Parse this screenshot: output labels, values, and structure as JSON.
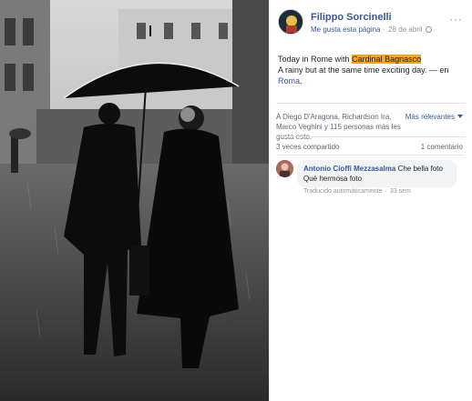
{
  "post": {
    "author": "Filippo Sorcinelli",
    "follow_label": "Me gusta esta página",
    "date": "28 de abril",
    "more_label": "···",
    "text_prefix": "Today in Rome with ",
    "text_highlight": "Cardinal Bagnasco",
    "text_line2": "A rainy but at the same time exciting day.",
    "text_place_sep": " — en ",
    "place": "Roma",
    "place_period": "."
  },
  "stats": {
    "reactions": "A Diego D'Aragona, Richardson Ira, Marco Veghini y 115 personas más les gusta esto.",
    "relevance_label": "Más relevantes",
    "shares": "3 veces compartido",
    "comments": "1 comentario"
  },
  "comment": {
    "author": "Antonio Cioffi Mezzasalma",
    "text": "Che bella foto",
    "translation": "Qué hermosa foto",
    "translation_note": "Traducido automáticamente",
    "age": "33 sem"
  },
  "colors": {
    "link": "#385898",
    "highlight": "#f7a51b"
  }
}
